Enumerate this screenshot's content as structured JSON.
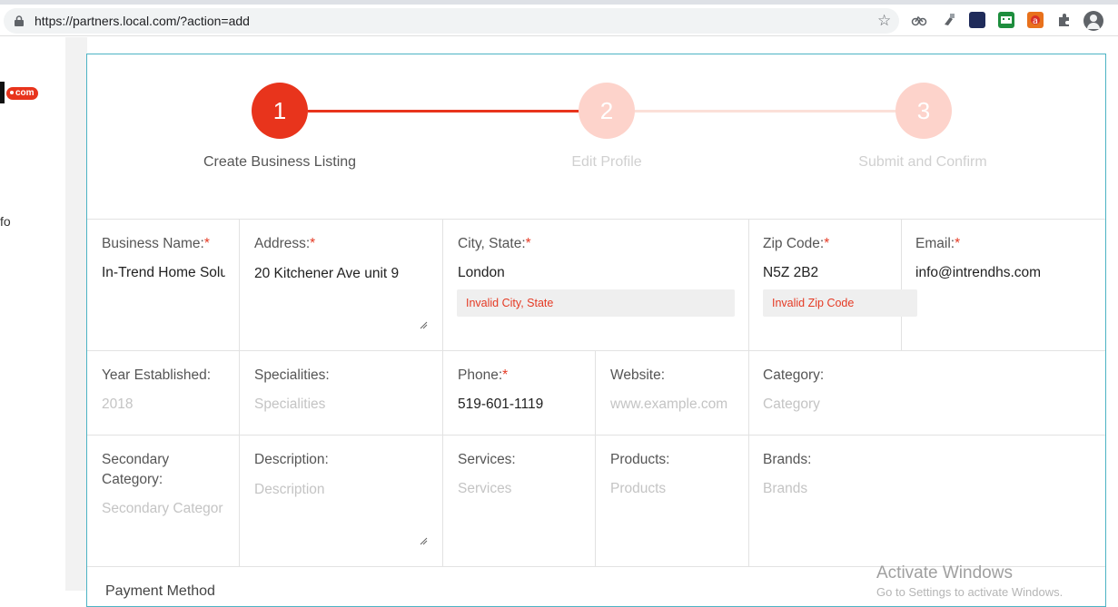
{
  "browser": {
    "url": "https://partners.local.com/?action=add",
    "icons": [
      "lock-icon",
      "star-icon",
      "extension-icons",
      "puzzle-icon",
      "profile-avatar-icon"
    ]
  },
  "sidebar": {
    "logo_suffix": "com",
    "partial_text": "fo"
  },
  "stepper": {
    "steps": [
      {
        "number": "1",
        "label": "Create Business Listing",
        "state": "active"
      },
      {
        "number": "2",
        "label": "Edit Profile",
        "state": "inactive"
      },
      {
        "number": "3",
        "label": "Submit and Confirm",
        "state": "inactive"
      }
    ]
  },
  "form": {
    "business_name": {
      "label": "Business Name:",
      "required": "*",
      "value": "In-Trend Home Solu"
    },
    "address": {
      "label": "Address:",
      "required": "*",
      "value": "20 Kitchener Ave unit 9"
    },
    "city_state": {
      "label": "City, State:",
      "required": "*",
      "value": "London",
      "error": "Invalid City, State"
    },
    "zip_code": {
      "label": "Zip Code:",
      "required": "*",
      "value": "N5Z 2B2",
      "error": "Invalid Zip Code"
    },
    "email": {
      "label": "Email:",
      "required": "*",
      "value": "info@intrendhs.com"
    },
    "year_established": {
      "label": "Year Established:",
      "placeholder": "2018"
    },
    "specialities": {
      "label": "Specialities:",
      "placeholder": "Specialities"
    },
    "phone": {
      "label": "Phone:",
      "required": "*",
      "value": "519-601-1119"
    },
    "website": {
      "label": "Website:",
      "placeholder": "www.example.com"
    },
    "category": {
      "label": "Category:",
      "placeholder": "Category"
    },
    "secondary_category": {
      "label": "Secondary Category:",
      "placeholder": "Secondary Categor"
    },
    "description": {
      "label": "Description:",
      "placeholder": "Description"
    },
    "services": {
      "label": "Services:",
      "placeholder": "Services"
    },
    "products": {
      "label": "Products:",
      "placeholder": "Products"
    },
    "brands": {
      "label": "Brands:",
      "placeholder": "Brands"
    },
    "next_section_partial": "Payment Method"
  },
  "watermark": {
    "line1": "Activate Windows",
    "line2": "Go to Settings to activate Windows."
  },
  "colors": {
    "accent": "#e8341c",
    "step_inactive": "#fdd3cb",
    "error_text": "#e53a24",
    "card_border": "#4db3c4"
  }
}
